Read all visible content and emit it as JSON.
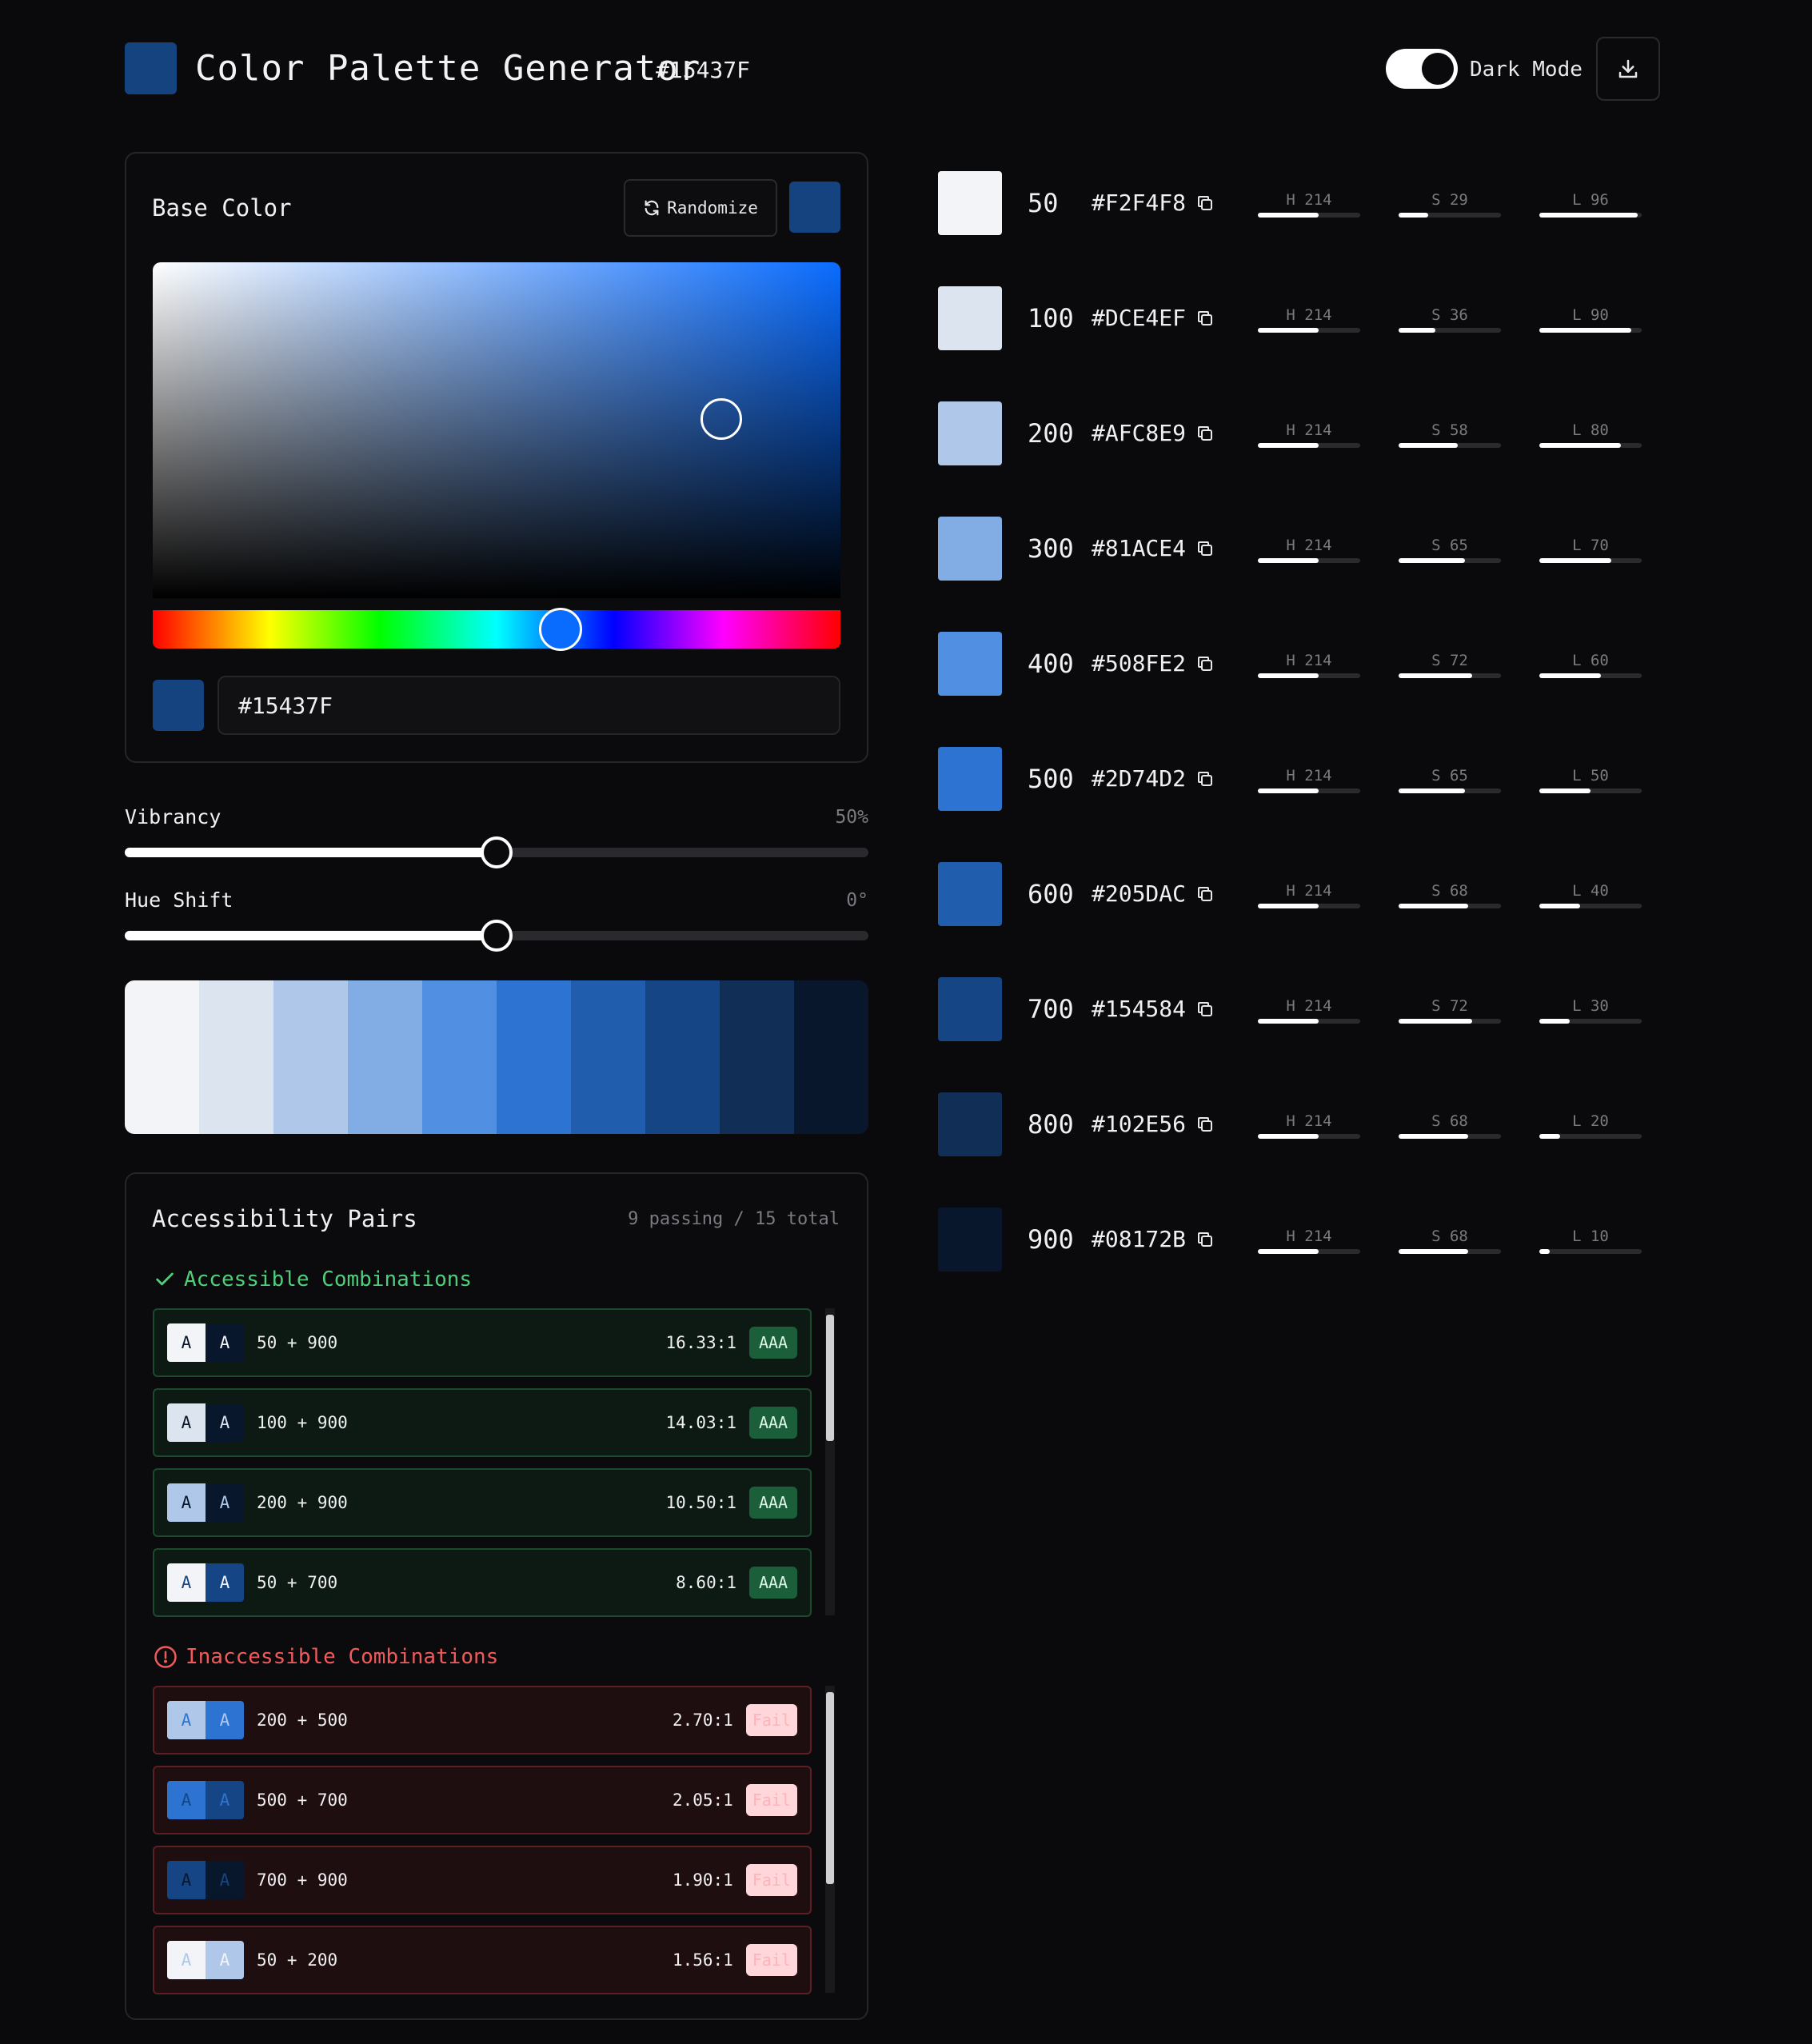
{
  "header": {
    "title": "Color Palette Generator",
    "hex": "#15437F",
    "logo_color": "#15437F",
    "mode_label": "Dark Mode",
    "download_icon": "download-icon"
  },
  "base": {
    "title": "Base Color",
    "randomize_label": "Randomize",
    "randomize_icon": "refresh-icon",
    "color": "#15437F",
    "hex_value": "#15437F"
  },
  "controls": {
    "vibrancy": {
      "label": "Vibrancy",
      "value_text": "50%",
      "value": 0.5
    },
    "hue_shift": {
      "label": "Hue Shift",
      "value_text": "0°",
      "value": 0.5
    }
  },
  "preview": [
    "#F2F4F8",
    "#DCE4EF",
    "#AFC8E9",
    "#81ACE4",
    "#508FE2",
    "#2D74D2",
    "#205DAC",
    "#154584",
    "#102E56",
    "#08172B"
  ],
  "accessibility": {
    "title": "Accessibility Pairs",
    "count": "9 passing / 15 total",
    "pass_heading": "Accessible Combinations",
    "fail_heading": "Inaccessible Combinations",
    "pass": [
      {
        "label": "50 + 900",
        "ratio": "16.33:1",
        "badge": "AAA",
        "bg": "#F2F4F8",
        "fg": "#08172B"
      },
      {
        "label": "100 + 900",
        "ratio": "14.03:1",
        "badge": "AAA",
        "bg": "#DCE4EF",
        "fg": "#08172B"
      },
      {
        "label": "200 + 900",
        "ratio": "10.50:1",
        "badge": "AAA",
        "bg": "#AFC8E9",
        "fg": "#08172B"
      },
      {
        "label": "50 + 700",
        "ratio": "8.60:1",
        "badge": "AAA",
        "bg": "#F2F4F8",
        "fg": "#154584"
      }
    ],
    "fail": [
      {
        "label": "200 + 500",
        "ratio": "2.70:1",
        "badge": "Fail",
        "bg": "#AFC8E9",
        "fg": "#2D74D2"
      },
      {
        "label": "500 + 700",
        "ratio": "2.05:1",
        "badge": "Fail",
        "bg": "#2D74D2",
        "fg": "#154584"
      },
      {
        "label": "700 + 900",
        "ratio": "1.90:1",
        "badge": "Fail",
        "bg": "#154584",
        "fg": "#08172B"
      },
      {
        "label": "50 + 200",
        "ratio": "1.56:1",
        "badge": "Fail",
        "bg": "#F2F4F8",
        "fg": "#AFC8E9"
      }
    ],
    "chip_letter": "A"
  },
  "shades": [
    {
      "name": "50",
      "hex": "#F2F4F8",
      "h": "H 214",
      "s": "S 29",
      "l": "L 96",
      "hv": 0.59,
      "sv": 0.29,
      "lv": 0.96
    },
    {
      "name": "100",
      "hex": "#DCE4EF",
      "h": "H 214",
      "s": "S 36",
      "l": "L 90",
      "hv": 0.59,
      "sv": 0.36,
      "lv": 0.9
    },
    {
      "name": "200",
      "hex": "#AFC8E9",
      "h": "H 214",
      "s": "S 58",
      "l": "L 80",
      "hv": 0.59,
      "sv": 0.58,
      "lv": 0.8
    },
    {
      "name": "300",
      "hex": "#81ACE4",
      "h": "H 214",
      "s": "S 65",
      "l": "L 70",
      "hv": 0.59,
      "sv": 0.65,
      "lv": 0.7
    },
    {
      "name": "400",
      "hex": "#508FE2",
      "h": "H 214",
      "s": "S 72",
      "l": "L 60",
      "hv": 0.59,
      "sv": 0.72,
      "lv": 0.6
    },
    {
      "name": "500",
      "hex": "#2D74D2",
      "h": "H 214",
      "s": "S 65",
      "l": "L 50",
      "hv": 0.59,
      "sv": 0.65,
      "lv": 0.5
    },
    {
      "name": "600",
      "hex": "#205DAC",
      "h": "H 214",
      "s": "S 68",
      "l": "L 40",
      "hv": 0.59,
      "sv": 0.68,
      "lv": 0.4
    },
    {
      "name": "700",
      "hex": "#154584",
      "h": "H 214",
      "s": "S 72",
      "l": "L 30",
      "hv": 0.59,
      "sv": 0.72,
      "lv": 0.3
    },
    {
      "name": "800",
      "hex": "#102E56",
      "h": "H 214",
      "s": "S 68",
      "l": "L 20",
      "hv": 0.59,
      "sv": 0.68,
      "lv": 0.2
    },
    {
      "name": "900",
      "hex": "#08172B",
      "h": "H 214",
      "s": "S 68",
      "l": "L 10",
      "hv": 0.59,
      "sv": 0.68,
      "lv": 0.1
    }
  ]
}
